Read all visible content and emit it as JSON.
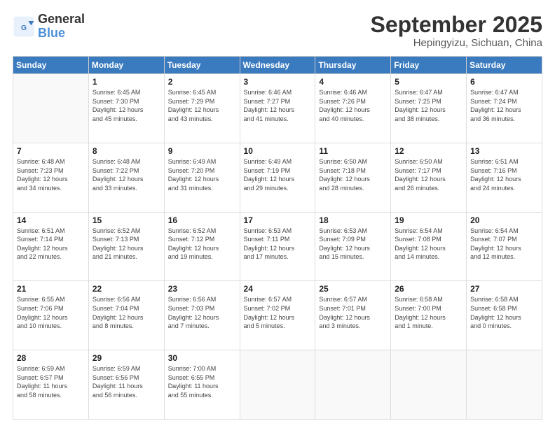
{
  "logo": {
    "line1": "General",
    "line2": "Blue"
  },
  "header": {
    "month": "September 2025",
    "location": "Hepingyizu, Sichuan, China"
  },
  "weekdays": [
    "Sunday",
    "Monday",
    "Tuesday",
    "Wednesday",
    "Thursday",
    "Friday",
    "Saturday"
  ],
  "weeks": [
    [
      {
        "num": "",
        "info": ""
      },
      {
        "num": "1",
        "info": "Sunrise: 6:45 AM\nSunset: 7:30 PM\nDaylight: 12 hours\nand 45 minutes."
      },
      {
        "num": "2",
        "info": "Sunrise: 6:45 AM\nSunset: 7:29 PM\nDaylight: 12 hours\nand 43 minutes."
      },
      {
        "num": "3",
        "info": "Sunrise: 6:46 AM\nSunset: 7:27 PM\nDaylight: 12 hours\nand 41 minutes."
      },
      {
        "num": "4",
        "info": "Sunrise: 6:46 AM\nSunset: 7:26 PM\nDaylight: 12 hours\nand 40 minutes."
      },
      {
        "num": "5",
        "info": "Sunrise: 6:47 AM\nSunset: 7:25 PM\nDaylight: 12 hours\nand 38 minutes."
      },
      {
        "num": "6",
        "info": "Sunrise: 6:47 AM\nSunset: 7:24 PM\nDaylight: 12 hours\nand 36 minutes."
      }
    ],
    [
      {
        "num": "7",
        "info": "Sunrise: 6:48 AM\nSunset: 7:23 PM\nDaylight: 12 hours\nand 34 minutes."
      },
      {
        "num": "8",
        "info": "Sunrise: 6:48 AM\nSunset: 7:22 PM\nDaylight: 12 hours\nand 33 minutes."
      },
      {
        "num": "9",
        "info": "Sunrise: 6:49 AM\nSunset: 7:20 PM\nDaylight: 12 hours\nand 31 minutes."
      },
      {
        "num": "10",
        "info": "Sunrise: 6:49 AM\nSunset: 7:19 PM\nDaylight: 12 hours\nand 29 minutes."
      },
      {
        "num": "11",
        "info": "Sunrise: 6:50 AM\nSunset: 7:18 PM\nDaylight: 12 hours\nand 28 minutes."
      },
      {
        "num": "12",
        "info": "Sunrise: 6:50 AM\nSunset: 7:17 PM\nDaylight: 12 hours\nand 26 minutes."
      },
      {
        "num": "13",
        "info": "Sunrise: 6:51 AM\nSunset: 7:16 PM\nDaylight: 12 hours\nand 24 minutes."
      }
    ],
    [
      {
        "num": "14",
        "info": "Sunrise: 6:51 AM\nSunset: 7:14 PM\nDaylight: 12 hours\nand 22 minutes."
      },
      {
        "num": "15",
        "info": "Sunrise: 6:52 AM\nSunset: 7:13 PM\nDaylight: 12 hours\nand 21 minutes."
      },
      {
        "num": "16",
        "info": "Sunrise: 6:52 AM\nSunset: 7:12 PM\nDaylight: 12 hours\nand 19 minutes."
      },
      {
        "num": "17",
        "info": "Sunrise: 6:53 AM\nSunset: 7:11 PM\nDaylight: 12 hours\nand 17 minutes."
      },
      {
        "num": "18",
        "info": "Sunrise: 6:53 AM\nSunset: 7:09 PM\nDaylight: 12 hours\nand 15 minutes."
      },
      {
        "num": "19",
        "info": "Sunrise: 6:54 AM\nSunset: 7:08 PM\nDaylight: 12 hours\nand 14 minutes."
      },
      {
        "num": "20",
        "info": "Sunrise: 6:54 AM\nSunset: 7:07 PM\nDaylight: 12 hours\nand 12 minutes."
      }
    ],
    [
      {
        "num": "21",
        "info": "Sunrise: 6:55 AM\nSunset: 7:06 PM\nDaylight: 12 hours\nand 10 minutes."
      },
      {
        "num": "22",
        "info": "Sunrise: 6:56 AM\nSunset: 7:04 PM\nDaylight: 12 hours\nand 8 minutes."
      },
      {
        "num": "23",
        "info": "Sunrise: 6:56 AM\nSunset: 7:03 PM\nDaylight: 12 hours\nand 7 minutes."
      },
      {
        "num": "24",
        "info": "Sunrise: 6:57 AM\nSunset: 7:02 PM\nDaylight: 12 hours\nand 5 minutes."
      },
      {
        "num": "25",
        "info": "Sunrise: 6:57 AM\nSunset: 7:01 PM\nDaylight: 12 hours\nand 3 minutes."
      },
      {
        "num": "26",
        "info": "Sunrise: 6:58 AM\nSunset: 7:00 PM\nDaylight: 12 hours\nand 1 minute."
      },
      {
        "num": "27",
        "info": "Sunrise: 6:58 AM\nSunset: 6:58 PM\nDaylight: 12 hours\nand 0 minutes."
      }
    ],
    [
      {
        "num": "28",
        "info": "Sunrise: 6:59 AM\nSunset: 6:57 PM\nDaylight: 11 hours\nand 58 minutes."
      },
      {
        "num": "29",
        "info": "Sunrise: 6:59 AM\nSunset: 6:56 PM\nDaylight: 11 hours\nand 56 minutes."
      },
      {
        "num": "30",
        "info": "Sunrise: 7:00 AM\nSunset: 6:55 PM\nDaylight: 11 hours\nand 55 minutes."
      },
      {
        "num": "",
        "info": ""
      },
      {
        "num": "",
        "info": ""
      },
      {
        "num": "",
        "info": ""
      },
      {
        "num": "",
        "info": ""
      }
    ]
  ]
}
